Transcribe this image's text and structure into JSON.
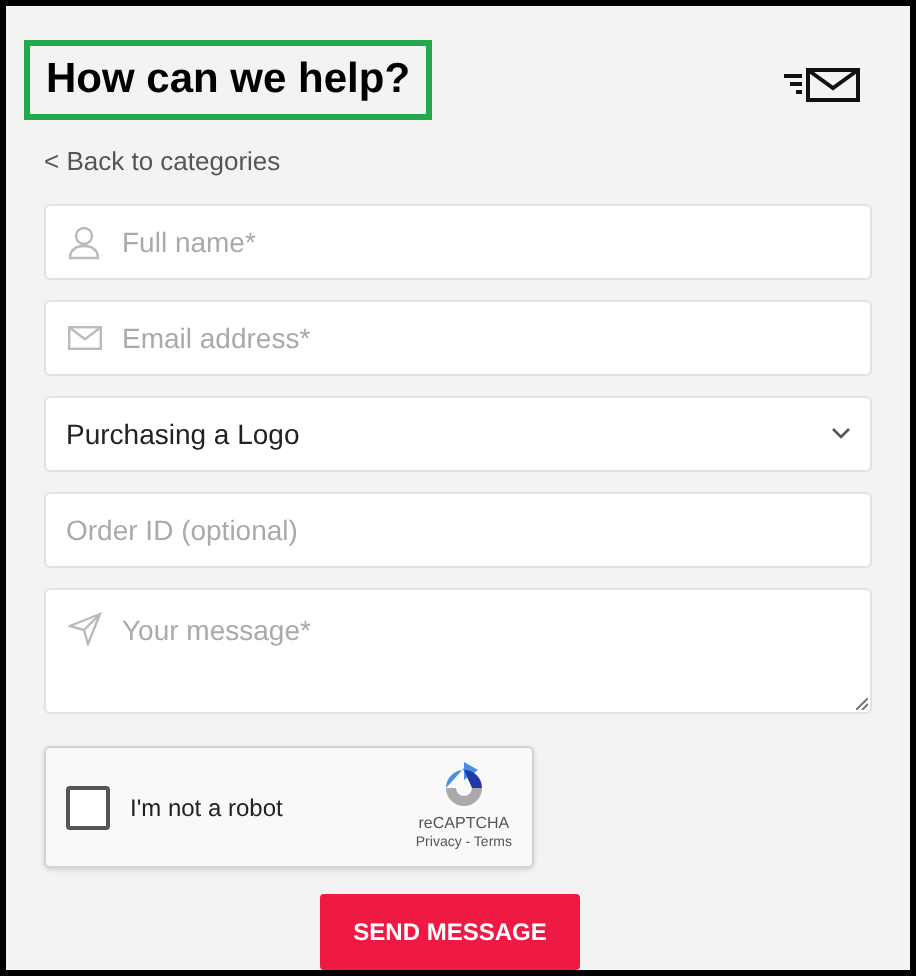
{
  "header": {
    "title": "How can we help?",
    "back_link": "< Back to categories"
  },
  "fields": [
    {
      "kind": "name",
      "placeholder": "Full name*"
    },
    {
      "kind": "email",
      "placeholder": "Email address*"
    },
    {
      "kind": "select",
      "value": "Purchasing a Logo"
    },
    {
      "kind": "text",
      "placeholder": "Order ID (optional)"
    },
    {
      "kind": "message",
      "placeholder": "Your message*"
    }
  ],
  "captcha": {
    "label": "I'm not a robot",
    "checked": false,
    "brand": "reCAPTCHA",
    "links": "Privacy - Terms"
  },
  "submit": {
    "label": "SEND MESSAGE"
  }
}
